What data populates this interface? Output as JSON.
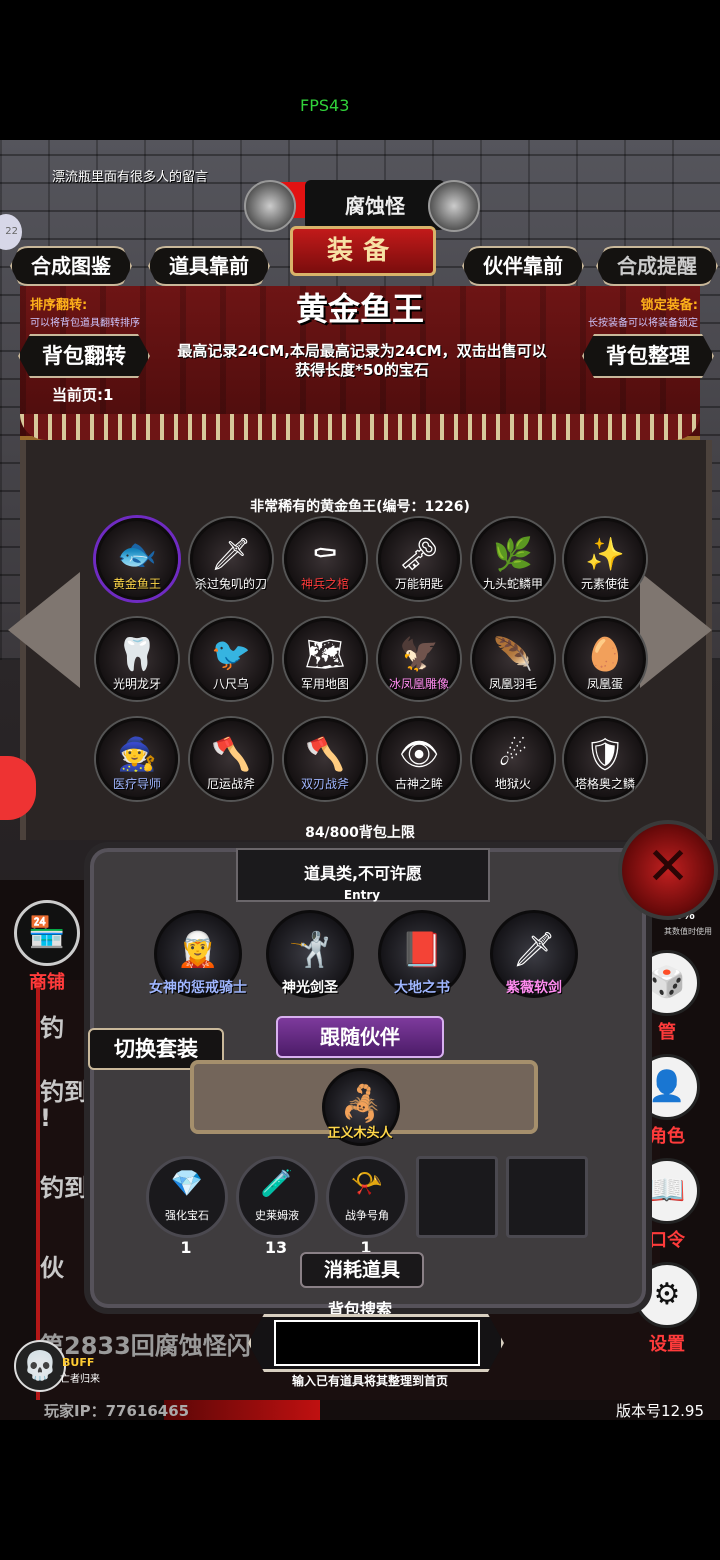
{
  "status": {
    "fps": "FPS43"
  },
  "top": {
    "bottle_msg": "漂流瓶里面有很多人的留言",
    "monster_name": "腐蚀怪",
    "equip_title": "装备",
    "buttons": [
      "合成图鉴",
      "道具靠前",
      "伙伴靠前",
      "合成提醒"
    ]
  },
  "banner": {
    "sort_title": "排序翻转:",
    "sort_sub": "可以将背包道具翻转排序",
    "lock_title": "锁定装备:",
    "lock_sub": "长按装备可以将装备锁定",
    "flip_button": "背包翻转",
    "tidy_button": "背包整理",
    "item_title": "黄金鱼王",
    "item_desc": "最高记录24CM,本局最高记录为24CM，双击出售可以获得长度*50的宝石",
    "current_page": "当前页:1"
  },
  "grid": {
    "header": "非常稀有的黄金鱼王(编号：1226)",
    "items": [
      {
        "label": "黄金鱼王",
        "color": "#ffd84a",
        "icon": "golden-fish-icon",
        "glyph": "🐟"
      },
      {
        "label": "杀过兔叽的刀",
        "color": "#ffffff",
        "icon": "knife-icon",
        "glyph": "🗡"
      },
      {
        "label": "神兵之棺",
        "color": "#ff3b3b",
        "icon": "coffin-icon",
        "glyph": "⚰"
      },
      {
        "label": "万能钥匙",
        "color": "#ffffff",
        "icon": "key-icon",
        "glyph": "🗝"
      },
      {
        "label": "九头蛇鳞甲",
        "color": "#ffffff",
        "icon": "hydra-armor-icon",
        "glyph": "🌿"
      },
      {
        "label": "元素使徒",
        "color": "#ffffff",
        "icon": "element-apostle-icon",
        "glyph": "✨"
      },
      {
        "label": "光明龙牙",
        "color": "#ffffff",
        "icon": "dragon-fang-icon",
        "glyph": "🦷"
      },
      {
        "label": "八尺乌",
        "color": "#ffffff",
        "icon": "crow-icon",
        "glyph": "🐦"
      },
      {
        "label": "军用地图",
        "color": "#ffffff",
        "icon": "map-icon",
        "glyph": "🗺"
      },
      {
        "label": "冰凤凰雕像",
        "color": "#ff8cf0",
        "icon": "ice-phoenix-icon",
        "glyph": "🦅"
      },
      {
        "label": "凤凰羽毛",
        "color": "#ffffff",
        "icon": "feather-icon",
        "glyph": "🪶"
      },
      {
        "label": "凤凰蛋",
        "color": "#ffffff",
        "icon": "egg-icon",
        "glyph": "🥚"
      },
      {
        "label": "医疗导师",
        "color": "#9fb6ff",
        "icon": "medic-icon",
        "glyph": "🧙"
      },
      {
        "label": "厄运战斧",
        "color": "#ffffff",
        "icon": "doom-axe-icon",
        "glyph": "🪓"
      },
      {
        "label": "双刃战斧",
        "color": "#9fb6ff",
        "icon": "double-axe-icon",
        "glyph": "🪓"
      },
      {
        "label": "古神之眸",
        "color": "#ffffff",
        "icon": "eye-icon",
        "glyph": "👁"
      },
      {
        "label": "地狱火",
        "color": "#ffffff",
        "icon": "hellfire-icon",
        "glyph": "☄"
      },
      {
        "label": "塔格奥之鳞",
        "color": "#ffffff",
        "icon": "scale-icon",
        "glyph": "🛡"
      }
    ],
    "bag_limit": "84/800背包上限"
  },
  "lower": {
    "category": "道具类,不可许愿",
    "entry": "Entry",
    "partners": [
      {
        "label": "女神的惩戒骑士",
        "color": "#9fb6ff",
        "glyph": "🧝"
      },
      {
        "label": "神光剑圣",
        "color": "#ffffff",
        "glyph": "🤺"
      },
      {
        "label": "大地之书",
        "color": "#9fb6ff",
        "glyph": "📕"
      },
      {
        "label": "紫薇软剑",
        "color": "#ff8cf0",
        "glyph": "🗡"
      }
    ],
    "switch_button": "切换套装",
    "follow_title": "跟随伙伴",
    "follow_partner": "正义木头人",
    "consumables": [
      {
        "label": "强化宝石",
        "count": "1",
        "glyph": "💎"
      },
      {
        "label": "史莱姆液",
        "count": "13",
        "glyph": "🧪"
      },
      {
        "label": "战争号角",
        "count": "1",
        "glyph": "📯"
      }
    ],
    "consume_title": "消耗道具",
    "search_title": "背包搜索",
    "search_value": "",
    "search_hint": "输入已有道具将其整理到首页"
  },
  "background": {
    "shop_label": "商铺",
    "lines": [
      "钓",
      "钓到",
      "!",
      "钓到",
      "伙",
      "第2833回腐蚀怪闪"
    ],
    "side_labels": [
      "管",
      "角色",
      "口令",
      "设置"
    ],
    "pct": "96%",
    "pct_sub": "其数值时使用",
    "buff": "BUFF",
    "buff_sub": "亡者归来",
    "player_ip": "玩家IP：77616465",
    "version": "版本号12.95",
    "left_bubble": "22"
  }
}
